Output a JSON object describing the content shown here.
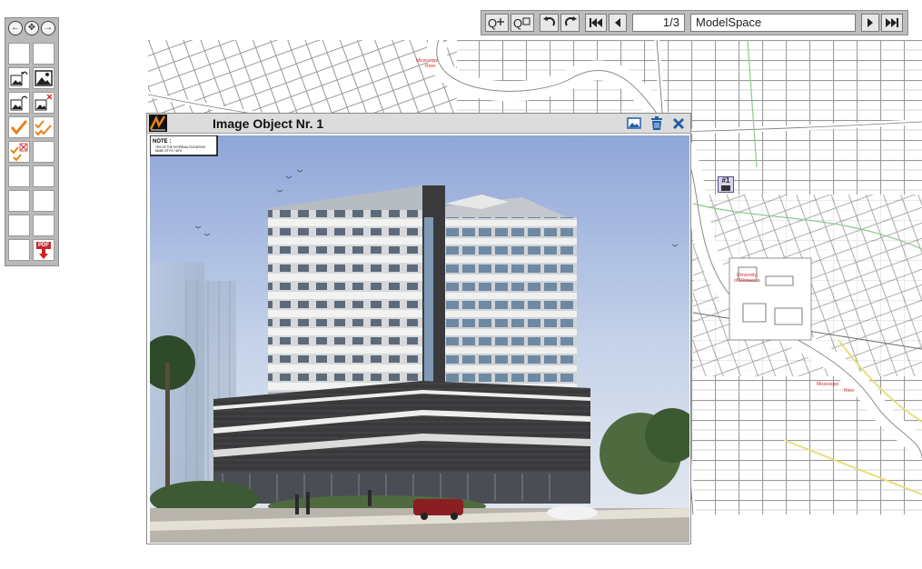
{
  "toolbar": {
    "page_indicator": "1/3",
    "space_name": "ModelSpace"
  },
  "image_window": {
    "title": "Image Object Nr. 1"
  },
  "image_note": {
    "heading": "NOTE :",
    "line1": "75% OF THE EXTERNAL ELEVATION",
    "line2": "MADE OF FG +40%"
  },
  "map_labels": {
    "river_top": "Mississippi",
    "river_top_sub": "River",
    "university": "University",
    "university_sub": "of Minnesota",
    "river_bottom": "Mississippi",
    "river_bottom_sub": "River"
  },
  "marker": {
    "label": "#1"
  },
  "palette": {
    "pdf_label": "PDF"
  },
  "colors": {
    "toolbar_bg": "#bdbdbd",
    "window_title_bg": "#dcdcdc",
    "accent_blue": "#1f5fa8",
    "check_orange": "#e8821a",
    "map_red_label": "#d03030"
  }
}
